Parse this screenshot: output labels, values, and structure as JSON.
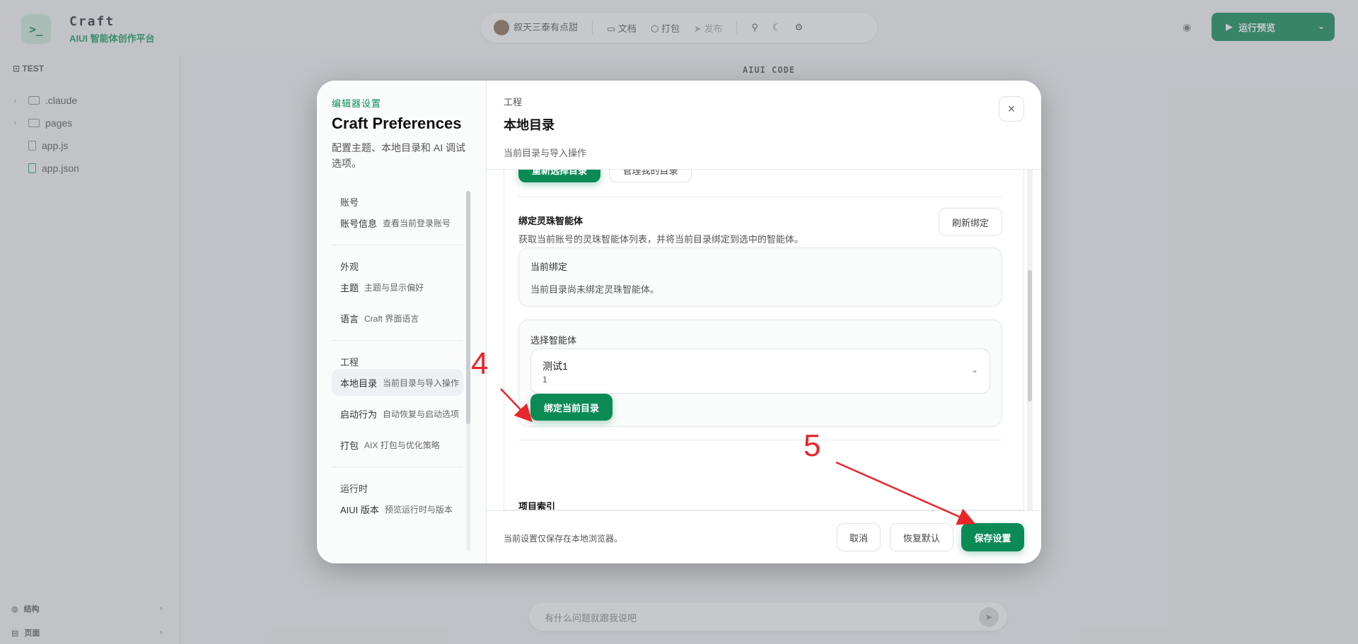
{
  "app": {
    "logo_glyph": ">_",
    "name": "Craft",
    "subtitle": "AIUI 智能体创作平台",
    "top_pill": {
      "user": "叙天三泰有点甜",
      "docs": "文档",
      "package": "打包",
      "publish": "发布"
    },
    "run_button": "运行预览",
    "project_name": "TEST",
    "tree": [
      {
        "name": ".claude",
        "type": "folder"
      },
      {
        "name": "pages",
        "type": "folder"
      },
      {
        "name": "app.js",
        "type": "file"
      },
      {
        "name": "app.json",
        "type": "file"
      }
    ],
    "editor_title": "AIUI CODE",
    "bottom": {
      "item1": "结构",
      "item2": "页面"
    },
    "chat_placeholder": "有什么问题就跟我说吧"
  },
  "modal": {
    "left": {
      "eyebrow": "编辑器设置",
      "title": "Craft Preferences",
      "desc": "配置主题、本地目录和 AI 调试选项。",
      "groups": [
        {
          "title": "账号",
          "items": [
            {
              "label": "账号信息",
              "sub": "查看当前登录账号"
            }
          ]
        },
        {
          "title": "外观",
          "items": [
            {
              "label": "主题",
              "sub": "主题与显示偏好"
            },
            {
              "label": "语言",
              "sub": "Craft 界面语言"
            }
          ]
        },
        {
          "title": "工程",
          "items": [
            {
              "label": "本地目录",
              "sub": "当前目录与导入操作"
            },
            {
              "label": "启动行为",
              "sub": "自动恢复与启动选项"
            },
            {
              "label": "打包",
              "sub": "AIX 打包与优化策略"
            }
          ]
        },
        {
          "title": "运行时",
          "items": [
            {
              "label": "AIUI 版本",
              "sub": "预览运行时与版本"
            }
          ]
        }
      ]
    },
    "right": {
      "eyebrow": "工程",
      "title": "本地目录",
      "subtitle": "当前目录与导入操作",
      "close_glyph": "×",
      "reselect_button": "重新选择目录",
      "manage_button": "管理我的目录",
      "bind_section": {
        "title": "绑定灵珠智能体",
        "desc": "获取当前账号的灵珠智能体列表，并将当前目录绑定到选中的智能体。",
        "refresh_button": "刷新绑定",
        "current_label": "当前绑定",
        "current_text": "当前目录尚未绑定灵珠智能体。",
        "select_label": "选择智能体",
        "selected_name": "测试1",
        "selected_id": "1",
        "bind_button": "绑定当前目录"
      },
      "index_section_title": "项目索引"
    },
    "footer": {
      "note": "当前设置仅保存在本地浏览器。",
      "cancel": "取消",
      "reset": "恢复默认",
      "save": "保存设置"
    }
  },
  "annotations": {
    "step4": "4",
    "step5": "5",
    "color": "#e8262b"
  },
  "colors": {
    "accent": "#0b8a55"
  }
}
